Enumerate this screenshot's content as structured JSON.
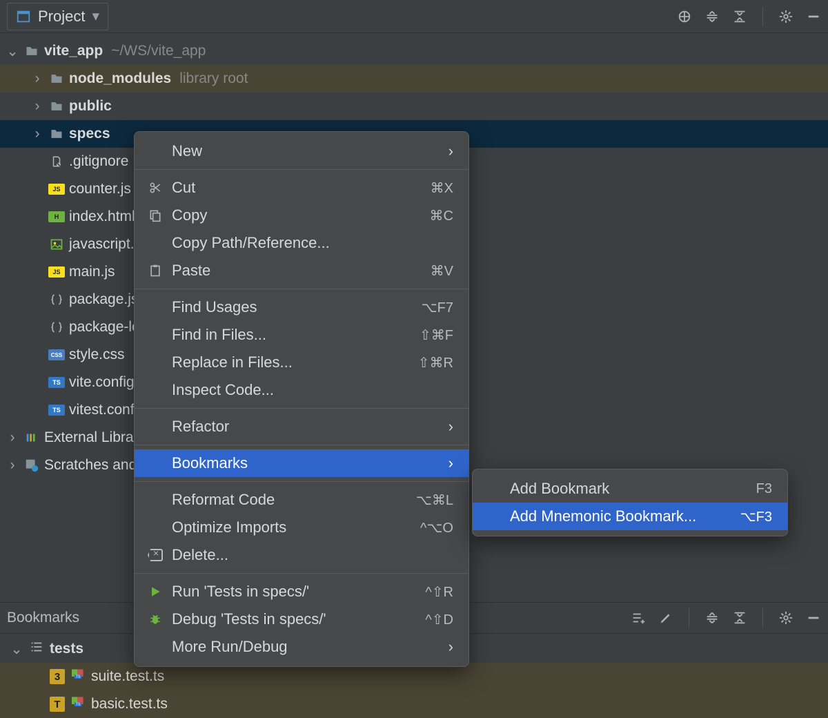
{
  "toolbar": {
    "title": "Project"
  },
  "tree": {
    "root": {
      "label": "vite_app",
      "path": "~/WS/vite_app"
    },
    "nodes": [
      {
        "label": "node_modules",
        "muted": "library root",
        "libroot": true
      },
      {
        "label": "public"
      },
      {
        "label": "specs",
        "selected": true
      }
    ],
    "files": [
      {
        "label": ".gitignore",
        "kind": "txt"
      },
      {
        "label": "counter.js",
        "kind": "js"
      },
      {
        "label": "index.html",
        "kind": "html"
      },
      {
        "label": "javascript.svg",
        "kind": "img"
      },
      {
        "label": "main.js",
        "kind": "js"
      },
      {
        "label": "package.json",
        "kind": "json"
      },
      {
        "label": "package-lock.json",
        "kind": "json"
      },
      {
        "label": "style.css",
        "kind": "css"
      },
      {
        "label": "vite.config.js",
        "kind": "ts"
      },
      {
        "label": "vitest.config.js",
        "kind": "ts"
      }
    ],
    "extras": [
      {
        "label": "External Libraries",
        "icon": "lib"
      },
      {
        "label": "Scratches and Consoles",
        "icon": "scratch"
      }
    ]
  },
  "ctx": {
    "items": [
      {
        "label": "New",
        "submenu": true
      },
      {
        "sep": true
      },
      {
        "label": "Cut",
        "icon": "scissors",
        "shortcut": "⌘X"
      },
      {
        "label": "Copy",
        "icon": "copy",
        "shortcut": "⌘C"
      },
      {
        "label": "Copy Path/Reference..."
      },
      {
        "label": "Paste",
        "icon": "paste",
        "shortcut": "⌘V"
      },
      {
        "sep": true
      },
      {
        "label": "Find Usages",
        "shortcut": "⌥F7"
      },
      {
        "label": "Find in Files...",
        "shortcut": "⇧⌘F"
      },
      {
        "label": "Replace in Files...",
        "shortcut": "⇧⌘R"
      },
      {
        "label": "Inspect Code..."
      },
      {
        "sep": true
      },
      {
        "label": "Refactor",
        "submenu": true
      },
      {
        "sep": true
      },
      {
        "label": "Bookmarks",
        "submenu": true,
        "highlight": true
      },
      {
        "sep": true
      },
      {
        "label": "Reformat Code",
        "shortcut": "⌥⌘L"
      },
      {
        "label": "Optimize Imports",
        "shortcut": "^⌥O"
      },
      {
        "label": "Delete...",
        "icon": "backspace"
      },
      {
        "sep": true
      },
      {
        "label": "Run 'Tests in specs/'",
        "icon": "run",
        "shortcut": "^⇧R"
      },
      {
        "label": "Debug 'Tests in specs/'",
        "icon": "bug",
        "shortcut": "^⇧D"
      },
      {
        "label": "More Run/Debug",
        "submenu": true
      }
    ]
  },
  "submenu": {
    "items": [
      {
        "label": "Add Bookmark",
        "shortcut": "F3"
      },
      {
        "label": "Add Mnemonic Bookmark...",
        "shortcut": "⌥F3",
        "highlight": true
      }
    ]
  },
  "bookmarks": {
    "title": "Bookmarks",
    "group": "tests",
    "items": [
      {
        "mnemonic": "3",
        "label": "suite.test.ts"
      },
      {
        "mnemonic": "T",
        "label": "basic.test.ts"
      }
    ]
  }
}
